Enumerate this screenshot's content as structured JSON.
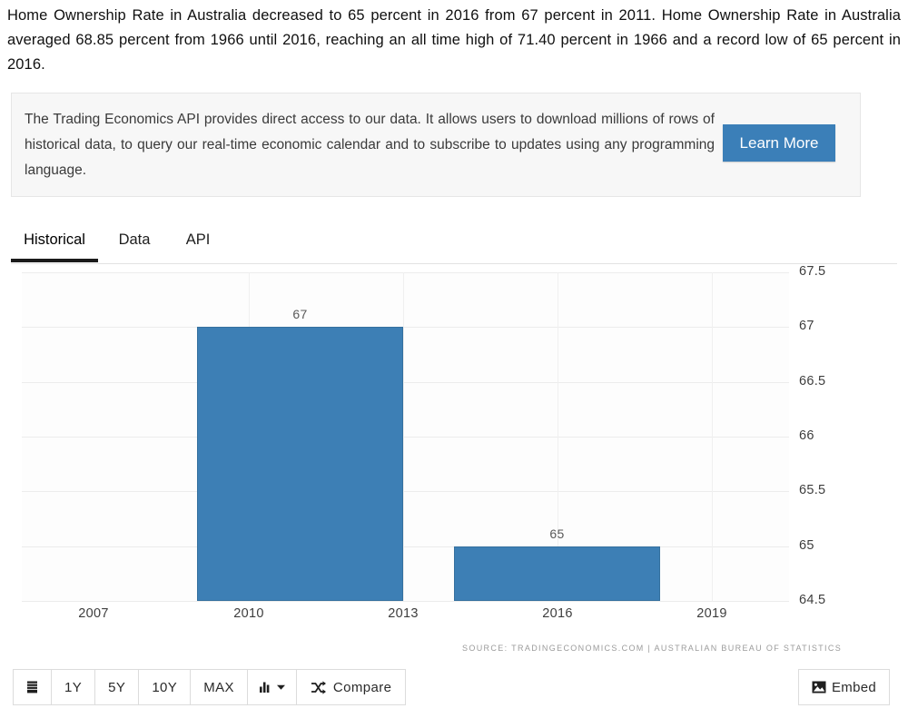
{
  "intro": {
    "paragraph": "Home Ownership Rate in Australia decreased to 65 percent in 2016 from 67 percent in 2011. Home Ownership Rate in Australia averaged 68.85 percent from 1966 until 2016, reaching an all time high of 71.40 percent in 1966 and a record low of 65 percent in 2016."
  },
  "api_banner": {
    "text": "The Trading Economics API provides direct access to our data. It allows users to download millions of rows of historical data, to query our real-time economic calendar and to subscribe to updates using any programming language.",
    "button_label": "Learn More",
    "button_color": "#3b7fb8"
  },
  "tabs": [
    {
      "label": "Historical",
      "active": true
    },
    {
      "label": "Data",
      "active": false
    },
    {
      "label": "API",
      "active": false
    }
  ],
  "chart_data": {
    "type": "bar",
    "title": "",
    "xlabel": "",
    "ylabel": "",
    "categories": [
      "2011",
      "2016"
    ],
    "values": [
      67,
      65
    ],
    "data_labels": [
      "67",
      "65"
    ],
    "ylim": [
      64.5,
      67.5
    ],
    "yticks": [
      "67.5",
      "67",
      "66.5",
      "66",
      "65.5",
      "65",
      "64.5"
    ],
    "ytick_values": [
      67.5,
      67,
      66.5,
      66,
      65.5,
      65,
      64.5
    ],
    "xticks": [
      "2007",
      "2010",
      "2013",
      "2016",
      "2019"
    ],
    "xtick_values": [
      2007,
      2010,
      2013,
      2016,
      2019
    ],
    "xlim": [
      2005.6,
      2020.5
    ],
    "grid": true,
    "legend": "none",
    "series_color": "#3d7fb5",
    "source": "SOURCE: TRADINGECONOMICS.COM  |  AUSTRALIAN BUREAU OF STATISTICS"
  },
  "toolbar": {
    "range_icon": "calendar-icon",
    "ranges": [
      "1Y",
      "5Y",
      "10Y",
      "MAX"
    ],
    "charttype_label": "",
    "compare_label": "Compare",
    "embed_label": "Embed"
  }
}
